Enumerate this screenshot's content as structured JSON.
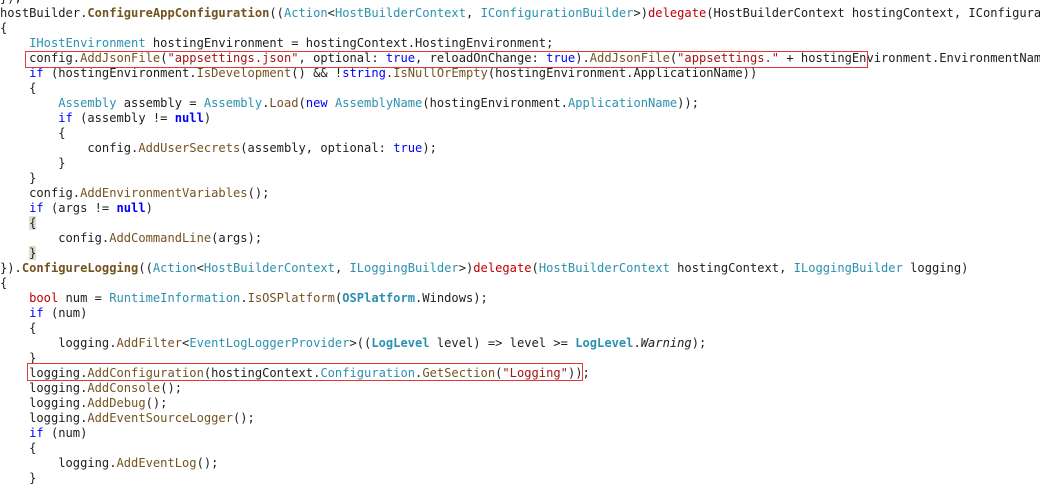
{
  "editor": {
    "lines": [
      [
        {
          "t": "});",
          "k": "plain"
        }
      ],
      [
        {
          "t": "hostBuilder.",
          "k": "plain"
        },
        {
          "t": "ConfigureAppConfiguration",
          "k": "methodb"
        },
        {
          "t": "((",
          "k": "plain"
        },
        {
          "t": "Action",
          "k": "type"
        },
        {
          "t": "<",
          "k": "plain"
        },
        {
          "t": "HostBuilderContext",
          "k": "type"
        },
        {
          "t": ", ",
          "k": "plain"
        },
        {
          "t": "IConfigurationBuilder",
          "k": "type"
        },
        {
          "t": ">)",
          "k": "plain"
        },
        {
          "t": "delegate",
          "k": "special"
        },
        {
          "t": "(HostBuilderContext hostingContext, IConfigurationBu",
          "k": "plain"
        }
      ],
      [
        {
          "t": "{",
          "k": "plain"
        }
      ],
      [
        {
          "t": "    ",
          "k": "plain"
        },
        {
          "t": "IHostEnvironment",
          "k": "type"
        },
        {
          "t": " hostingEnvironment = hostingContext.HostingEnvironment;",
          "k": "plain"
        }
      ],
      [
        {
          "t": "    config.",
          "k": "plain"
        },
        {
          "t": "AddJsonFile",
          "k": "method"
        },
        {
          "t": "(",
          "k": "plain"
        },
        {
          "t": "\"appsettings.json\"",
          "k": "str"
        },
        {
          "t": ", optional: ",
          "k": "plain"
        },
        {
          "t": "true",
          "k": "kw"
        },
        {
          "t": ", reloadOnChange: ",
          "k": "plain"
        },
        {
          "t": "true",
          "k": "kw"
        },
        {
          "t": ").",
          "k": "plain"
        },
        {
          "t": "AddJsonFile",
          "k": "method"
        },
        {
          "t": "(",
          "k": "plain"
        },
        {
          "t": "\"appsettings.\"",
          "k": "str"
        },
        {
          "t": " + hostingEnvironment.EnvironmentName + ",
          "k": "plain"
        },
        {
          "t": "\"",
          "k": "str"
        }
      ],
      [
        {
          "t": "    ",
          "k": "plain"
        },
        {
          "t": "if",
          "k": "kw"
        },
        {
          "t": " (hostingEnvironment.",
          "k": "plain"
        },
        {
          "t": "IsDevelopment",
          "k": "method"
        },
        {
          "t": "() && !",
          "k": "plain"
        },
        {
          "t": "string",
          "k": "kw"
        },
        {
          "t": ".",
          "k": "plain"
        },
        {
          "t": "IsNullOrEmpty",
          "k": "method"
        },
        {
          "t": "(hostingEnvironment.ApplicationName))",
          "k": "plain"
        }
      ],
      [
        {
          "t": "    {",
          "k": "plain"
        }
      ],
      [
        {
          "t": "        ",
          "k": "plain"
        },
        {
          "t": "Assembly",
          "k": "type"
        },
        {
          "t": " assembly = ",
          "k": "plain"
        },
        {
          "t": "Assembly",
          "k": "type"
        },
        {
          "t": ".",
          "k": "plain"
        },
        {
          "t": "Load",
          "k": "method"
        },
        {
          "t": "(",
          "k": "plain"
        },
        {
          "t": "new",
          "k": "kw"
        },
        {
          "t": " ",
          "k": "plain"
        },
        {
          "t": "AssemblyName",
          "k": "type"
        },
        {
          "t": "(hostingEnvironment.",
          "k": "plain"
        },
        {
          "t": "ApplicationName",
          "k": "type"
        },
        {
          "t": "));",
          "k": "plain"
        }
      ],
      [
        {
          "t": "        ",
          "k": "plain"
        },
        {
          "t": "if",
          "k": "kw"
        },
        {
          "t": " (assembly != ",
          "k": "plain"
        },
        {
          "t": "null",
          "k": "kwb"
        },
        {
          "t": ")",
          "k": "plain"
        }
      ],
      [
        {
          "t": "        {",
          "k": "plain"
        }
      ],
      [
        {
          "t": "            config.",
          "k": "plain"
        },
        {
          "t": "AddUserSecrets",
          "k": "method"
        },
        {
          "t": "(assembly, optional: ",
          "k": "plain"
        },
        {
          "t": "true",
          "k": "kw"
        },
        {
          "t": ");",
          "k": "plain"
        }
      ],
      [
        {
          "t": "        }",
          "k": "plain"
        }
      ],
      [
        {
          "t": "    }",
          "k": "plain"
        }
      ],
      [
        {
          "t": "    config.",
          "k": "plain"
        },
        {
          "t": "AddEnvironmentVariables",
          "k": "method"
        },
        {
          "t": "();",
          "k": "plain"
        }
      ],
      [
        {
          "t": "    ",
          "k": "plain"
        },
        {
          "t": "if",
          "k": "kw"
        },
        {
          "t": " (args != ",
          "k": "plain"
        },
        {
          "t": "null",
          "k": "kwb"
        },
        {
          "t": ")",
          "k": "plain"
        }
      ],
      [
        {
          "t": "    ",
          "k": "plain"
        },
        {
          "t": "{",
          "k": "brace"
        }
      ],
      [
        {
          "t": "        config.",
          "k": "plain"
        },
        {
          "t": "AddCommandLine",
          "k": "method"
        },
        {
          "t": "(args);",
          "k": "plain"
        }
      ],
      [
        {
          "t": "    ",
          "k": "plain"
        },
        {
          "t": "}",
          "k": "brace"
        }
      ],
      [
        {
          "t": "}).",
          "k": "plain"
        },
        {
          "t": "ConfigureLogging",
          "k": "methodb"
        },
        {
          "t": "((",
          "k": "plain"
        },
        {
          "t": "Action",
          "k": "type"
        },
        {
          "t": "<",
          "k": "plain"
        },
        {
          "t": "HostBuilderContext",
          "k": "type"
        },
        {
          "t": ", ",
          "k": "plain"
        },
        {
          "t": "ILoggingBuilder",
          "k": "type"
        },
        {
          "t": ">)",
          "k": "plain"
        },
        {
          "t": "delegate",
          "k": "special"
        },
        {
          "t": "(",
          "k": "plain"
        },
        {
          "t": "HostBuilderContext",
          "k": "type"
        },
        {
          "t": " hostingContext, ",
          "k": "plain"
        },
        {
          "t": "ILoggingBuilder",
          "k": "type"
        },
        {
          "t": " logging)",
          "k": "plain"
        }
      ],
      [
        {
          "t": "{",
          "k": "plain"
        }
      ],
      [
        {
          "t": "    ",
          "k": "plain"
        },
        {
          "t": "bool",
          "k": "special"
        },
        {
          "t": " num = ",
          "k": "plain"
        },
        {
          "t": "RuntimeInformation",
          "k": "type"
        },
        {
          "t": ".",
          "k": "plain"
        },
        {
          "t": "IsOSPlatform",
          "k": "method"
        },
        {
          "t": "(",
          "k": "plain"
        },
        {
          "t": "OSPlatform",
          "k": "typeb"
        },
        {
          "t": ".Windows);",
          "k": "plain"
        }
      ],
      [
        {
          "t": "    ",
          "k": "plain"
        },
        {
          "t": "if",
          "k": "kw"
        },
        {
          "t": " (num)",
          "k": "plain"
        }
      ],
      [
        {
          "t": "    {",
          "k": "plain"
        }
      ],
      [
        {
          "t": "        logging.",
          "k": "plain"
        },
        {
          "t": "AddFilter",
          "k": "method"
        },
        {
          "t": "<",
          "k": "plain"
        },
        {
          "t": "EventLogLoggerProvider",
          "k": "type"
        },
        {
          "t": ">((",
          "k": "plain"
        },
        {
          "t": "LogLevel",
          "k": "typeb"
        },
        {
          "t": " level) => level >= ",
          "k": "plain"
        },
        {
          "t": "LogLevel",
          "k": "typeb"
        },
        {
          "t": ".",
          "k": "plain"
        },
        {
          "t": "Warning",
          "k": "italic"
        },
        {
          "t": ");",
          "k": "plain"
        }
      ],
      [
        {
          "t": "    }",
          "k": "plain"
        }
      ],
      [
        {
          "t": "    logging.",
          "k": "plain"
        },
        {
          "t": "AddConfiguration",
          "k": "method"
        },
        {
          "t": "(hostingContext.",
          "k": "plain"
        },
        {
          "t": "Configuration",
          "k": "type"
        },
        {
          "t": ".",
          "k": "plain"
        },
        {
          "t": "GetSection",
          "k": "method"
        },
        {
          "t": "(",
          "k": "plain"
        },
        {
          "t": "\"Logging\"",
          "k": "str"
        },
        {
          "t": "));",
          "k": "plain"
        }
      ],
      [
        {
          "t": "    logging.",
          "k": "plain"
        },
        {
          "t": "AddConsole",
          "k": "method"
        },
        {
          "t": "();",
          "k": "plain"
        }
      ],
      [
        {
          "t": "    logging.",
          "k": "plain"
        },
        {
          "t": "AddDebug",
          "k": "method"
        },
        {
          "t": "();",
          "k": "plain"
        }
      ],
      [
        {
          "t": "    logging.",
          "k": "plain"
        },
        {
          "t": "AddEventSourceLogger",
          "k": "method"
        },
        {
          "t": "();",
          "k": "plain"
        }
      ],
      [
        {
          "t": "    ",
          "k": "plain"
        },
        {
          "t": "if",
          "k": "kw"
        },
        {
          "t": " (num)",
          "k": "plain"
        }
      ],
      [
        {
          "t": "    {",
          "k": "plain"
        }
      ],
      [
        {
          "t": "        logging.",
          "k": "plain"
        },
        {
          "t": "AddEventLog",
          "k": "method"
        },
        {
          "t": "();",
          "k": "plain"
        }
      ],
      [
        {
          "t": "    }",
          "k": "plain"
        }
      ]
    ],
    "colors": {
      "keyword": "#0000ff",
      "type": "#2b91af",
      "method": "#74531f",
      "string": "#a31515",
      "delegate": "#c00000",
      "highlight_border": "#e23a3a",
      "brace_match": "#dbe0cc"
    }
  }
}
